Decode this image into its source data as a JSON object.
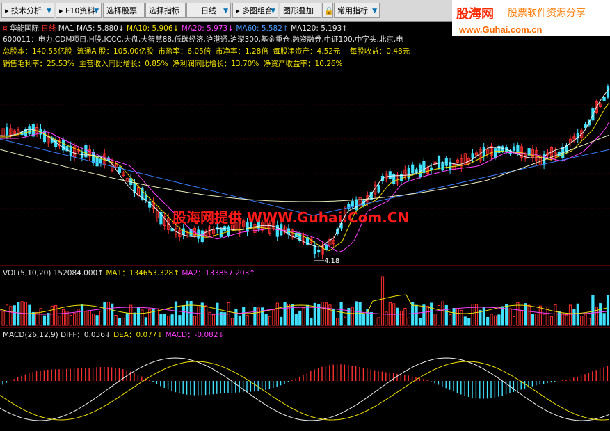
{
  "toolbar": {
    "items": [
      {
        "label": "技术分析"
      },
      {
        "label": "F10资料"
      },
      {
        "label": "选择股票"
      },
      {
        "label": "选择指标"
      },
      {
        "label": "日线"
      },
      {
        "label": "多图组合"
      },
      {
        "label": "图形叠加"
      },
      {
        "label": "常用指标"
      }
    ]
  },
  "brand": {
    "name": "股海网",
    "slogan": "股票软件资源分享",
    "url": "www.Guhai.com.cn"
  },
  "stock": {
    "name": "华能国际",
    "period": "日线"
  },
  "ma": {
    "ma1_label": "MA1",
    "ma5": "MA5: 5.880↓",
    "ma10": "MA10: 5.906↓",
    "ma20": "MA20: 5.973↓",
    "ma60": "MA60: 5.582↑",
    "ma120": "MA120: 5.193↑"
  },
  "concepts": "600011：电力,CDM项目,H股,ICCC,大盘,大智慧88,低碳经济,沪港通,沪深300,基金重仓,融资融券,中证100,中字头,北京,电",
  "fund1": {
    "total_shares": "总股本：140.55亿股",
    "float_shares": "流通A 股：105.00亿股",
    "pe": "市盈率：6.05倍",
    "pb": "市净率：1.28倍",
    "nav": "每股净资产：4.52元",
    "eps": "每股收益：0.48元"
  },
  "fund2": {
    "gross_margin": "销售毛利率：25.53%",
    "rev_growth": "主营收入同比增长：0.85%",
    "profit_growth": "净利润同比增长：13.70%",
    "roe": "净资产收益率：10.26%"
  },
  "watermark": "股海网提供 WWW.Guhai.Com.CN",
  "low_label": "4.18",
  "vol": {
    "title": "VOL(5,10,20)",
    "v": "152084.000↑",
    "ma1": "MA1：134653.328↑",
    "ma2": "MA2：133857.203↑"
  },
  "macd": {
    "title": "MACD(26,12,9)",
    "diff": "DIFF：0.036↓",
    "dea": "DEA：0.077↓",
    "macd": "MACD：-0.082↓"
  },
  "colors": {
    "up": "#ff3030",
    "down": "#40e0ff",
    "ma5": "#f0f0f0",
    "ma10": "#f0e000",
    "ma20": "#ff40ff",
    "ma60": "#3a7dff",
    "ma120": "#f0f0c0"
  }
}
